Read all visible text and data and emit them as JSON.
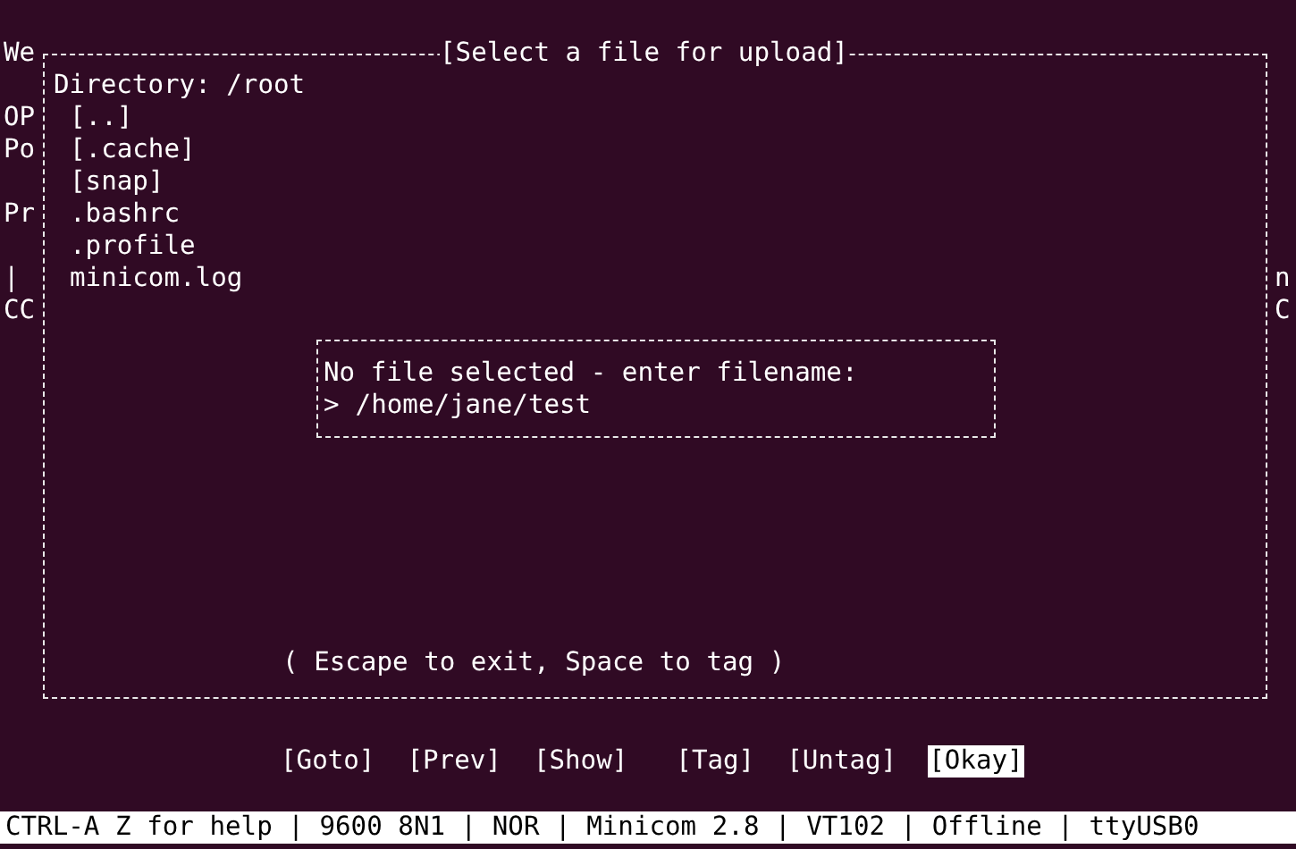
{
  "left_margin": [
    {
      "text": "We"
    },
    {
      "text": "OP"
    },
    {
      "text": "Po"
    },
    {
      "text": "Pr"
    },
    {
      "text": "|"
    },
    {
      "text": "CC"
    }
  ],
  "right_margin": [
    {
      "text": "n"
    },
    {
      "text": "C"
    }
  ],
  "dialog": {
    "title": "[Select a file for upload]",
    "directory": "Directory: /root",
    "files": [
      {
        "name": "[..]"
      },
      {
        "name": "[.cache]"
      },
      {
        "name": "[snap]"
      },
      {
        "name": ".bashrc"
      },
      {
        "name": ".profile"
      },
      {
        "name": "minicom.log"
      }
    ],
    "prompt": {
      "message": "No file selected - enter filename:",
      "marker": ">",
      "value": "/home/jane/test"
    },
    "hint": "( Escape to exit, Space to tag )"
  },
  "buttons": [
    {
      "label": "[Goto]",
      "selected": false
    },
    {
      "label": "[Prev]",
      "selected": false
    },
    {
      "label": "[Show]",
      "selected": false
    },
    {
      "label": "[Tag]",
      "selected": false
    },
    {
      "label": "[Untag]",
      "selected": false
    },
    {
      "label": "[Okay]",
      "selected": true
    }
  ],
  "status_bar": "CTRL-A Z for help | 9600 8N1 | NOR | Minicom 2.8 | VT102 | Offline | ttyUSB0"
}
